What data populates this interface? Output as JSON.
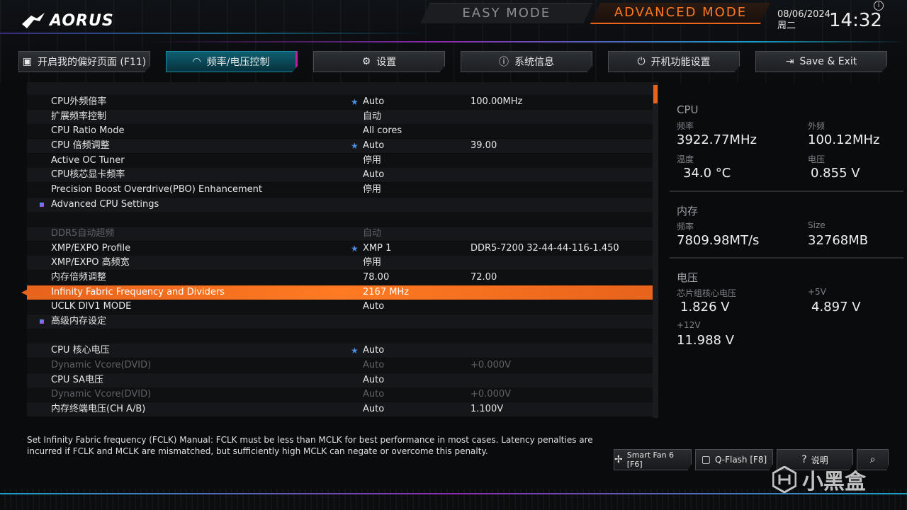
{
  "brand": "AORUS",
  "modes": {
    "easy": "EASY MODE",
    "advanced": "ADVANCED MODE"
  },
  "clock": {
    "date": "08/06/2024",
    "weekday": "周二",
    "time": "14:32"
  },
  "tabs": [
    {
      "label": "开启我的偏好页面 (F11)",
      "icon": "favorites-icon"
    },
    {
      "label": "频率/电压控制",
      "icon": "gauge-icon"
    },
    {
      "label": "设置",
      "icon": "gear-icon"
    },
    {
      "label": "系统信息",
      "icon": "info-icon"
    },
    {
      "label": "开机功能设置",
      "icon": "power-icon"
    },
    {
      "label": "Save & Exit",
      "icon": "exit-icon"
    }
  ],
  "rows": [
    {
      "label": "",
      "v1": "",
      "v2": ""
    },
    {
      "label": "CPU外频倍率",
      "v1": "Auto",
      "v2": "100.00MHz"
    },
    {
      "label": "扩展频率控制",
      "v1": "自动",
      "v2": ""
    },
    {
      "label": "CPU Ratio Mode",
      "v1": "All cores",
      "v2": ""
    },
    {
      "label": "CPU 倍频调整",
      "v1": "Auto",
      "v2": "39.00"
    },
    {
      "label": "Active OC Tuner",
      "v1": "停用",
      "v2": ""
    },
    {
      "label": "CPU核芯显卡频率",
      "v1": "Auto",
      "v2": ""
    },
    {
      "label": "Precision Boost Overdrive(PBO) Enhancement",
      "v1": "停用",
      "v2": ""
    },
    {
      "label": "Advanced CPU Settings",
      "v1": "",
      "v2": ""
    },
    {
      "label": "",
      "v1": "",
      "v2": ""
    },
    {
      "label": "DDR5自动超频",
      "v1": "自动",
      "v2": ""
    },
    {
      "label": "XMP/EXPO Profile",
      "v1": "XMP 1",
      "v2": "DDR5-7200 32-44-44-116-1.450"
    },
    {
      "label": "XMP/EXPO 高频宽",
      "v1": "停用",
      "v2": ""
    },
    {
      "label": "内存倍频调整",
      "v1": "78.00",
      "v2": "72.00"
    },
    {
      "label": "Infinity Fabric Frequency and Dividers",
      "v1": "2167 MHz",
      "v2": ""
    },
    {
      "label": "UCLK DIV1 MODE",
      "v1": "Auto",
      "v2": ""
    },
    {
      "label": "高级内存设定",
      "v1": "",
      "v2": ""
    },
    {
      "label": "",
      "v1": "",
      "v2": ""
    },
    {
      "label": "CPU 核心电压",
      "v1": "Auto",
      "v2": ""
    },
    {
      "label": "Dynamic Vcore(DVID)",
      "v1": "Auto",
      "v2": "+0.000V"
    },
    {
      "label": "CPU SA电压",
      "v1": "Auto",
      "v2": ""
    },
    {
      "label": "Dynamic Vcore(DVID)",
      "v1": "Auto",
      "v2": "+0.000V"
    },
    {
      "label": "内存终端电压(CH A/B)",
      "v1": "Auto",
      "v2": "1.100V"
    }
  ],
  "panel": {
    "cpu": {
      "title": "CPU",
      "freq_k": "频率",
      "freq_v": "3922.77MHz",
      "bclk_k": "外频",
      "bclk_v": "100.12MHz",
      "temp_k": "温度",
      "temp_v": "34.0 °C",
      "volt_k": "电压",
      "volt_v": "0.855 V"
    },
    "mem": {
      "title": "内存",
      "freq_k": "频率",
      "freq_v": "7809.98MT/s",
      "size_k": "Size",
      "size_v": "32768MB"
    },
    "volt": {
      "title": "电压",
      "chip_k": "芯片组核心电压",
      "chip_v": "1.826 V",
      "p5_k": "+5V",
      "p5_v": "4.897 V",
      "p12_k": "+12V",
      "p12_v": "11.988 V"
    }
  },
  "help": "Set Infinity Fabric frequency (FCLK) Manual: FCLK must be less than MCLK for best performance in most cases. Latency penalties are incurred if FCLK and MCLK are mismatched, but sufficiently high MCLK can negate or overcome this penalty.",
  "bottom_buttons": [
    {
      "label": "Smart Fan 6 [F6]",
      "icon": "fan-icon"
    },
    {
      "label": "Q-Flash [F8]",
      "icon": "chip-icon"
    },
    {
      "label": "说明",
      "icon": "help-icon"
    },
    {
      "label": "",
      "icon": "search-icon"
    }
  ],
  "watermark": "小黑盒",
  "colors": {
    "accent": "#e8631b",
    "active_tab": "#0d5f72",
    "star": "#4c8fe0"
  }
}
